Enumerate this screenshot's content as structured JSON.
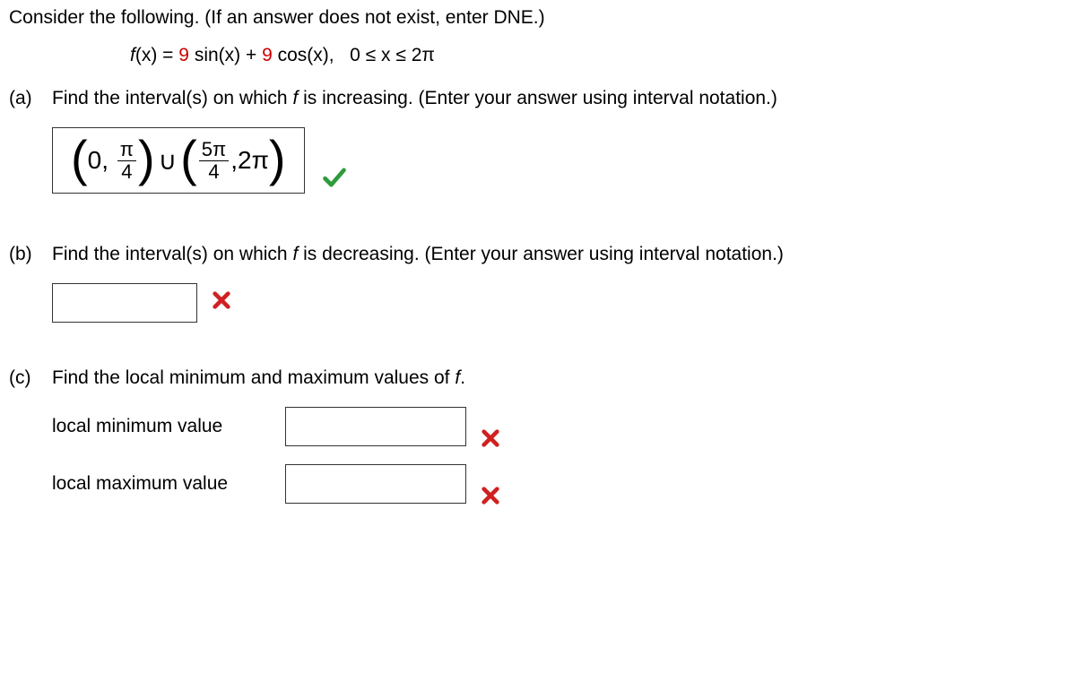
{
  "intro": "Consider the following. (If an answer does not exist, enter DNE.)",
  "equation": {
    "lhs_f": "f",
    "lhs_x": "(x)",
    "eq": " = ",
    "coef1": "9",
    "sin": "sin(x)",
    "plus": " + ",
    "coef2": "9",
    "cos": "cos(x),",
    "domain": "0 ≤ x ≤ 2π"
  },
  "parts": {
    "a": {
      "label": "(a)",
      "prompt": "Find the interval(s) on which f is increasing. (Enter your answer using interval notation.)",
      "answer": {
        "open1": "0",
        "num1_top": "π",
        "num1_bot": "4",
        "num2_top": "5π",
        "num2_bot": "4",
        "close2": "2π"
      },
      "status": "correct"
    },
    "b": {
      "label": "(b)",
      "prompt": "Find the interval(s) on which f is decreasing. (Enter your answer using interval notation.)",
      "status": "incorrect"
    },
    "c": {
      "label": "(c)",
      "prompt": "Find the local minimum and maximum values of f.",
      "rows": {
        "min": "local minimum value",
        "max": "local maximum value"
      },
      "status_min": "incorrect",
      "status_max": "incorrect"
    }
  }
}
